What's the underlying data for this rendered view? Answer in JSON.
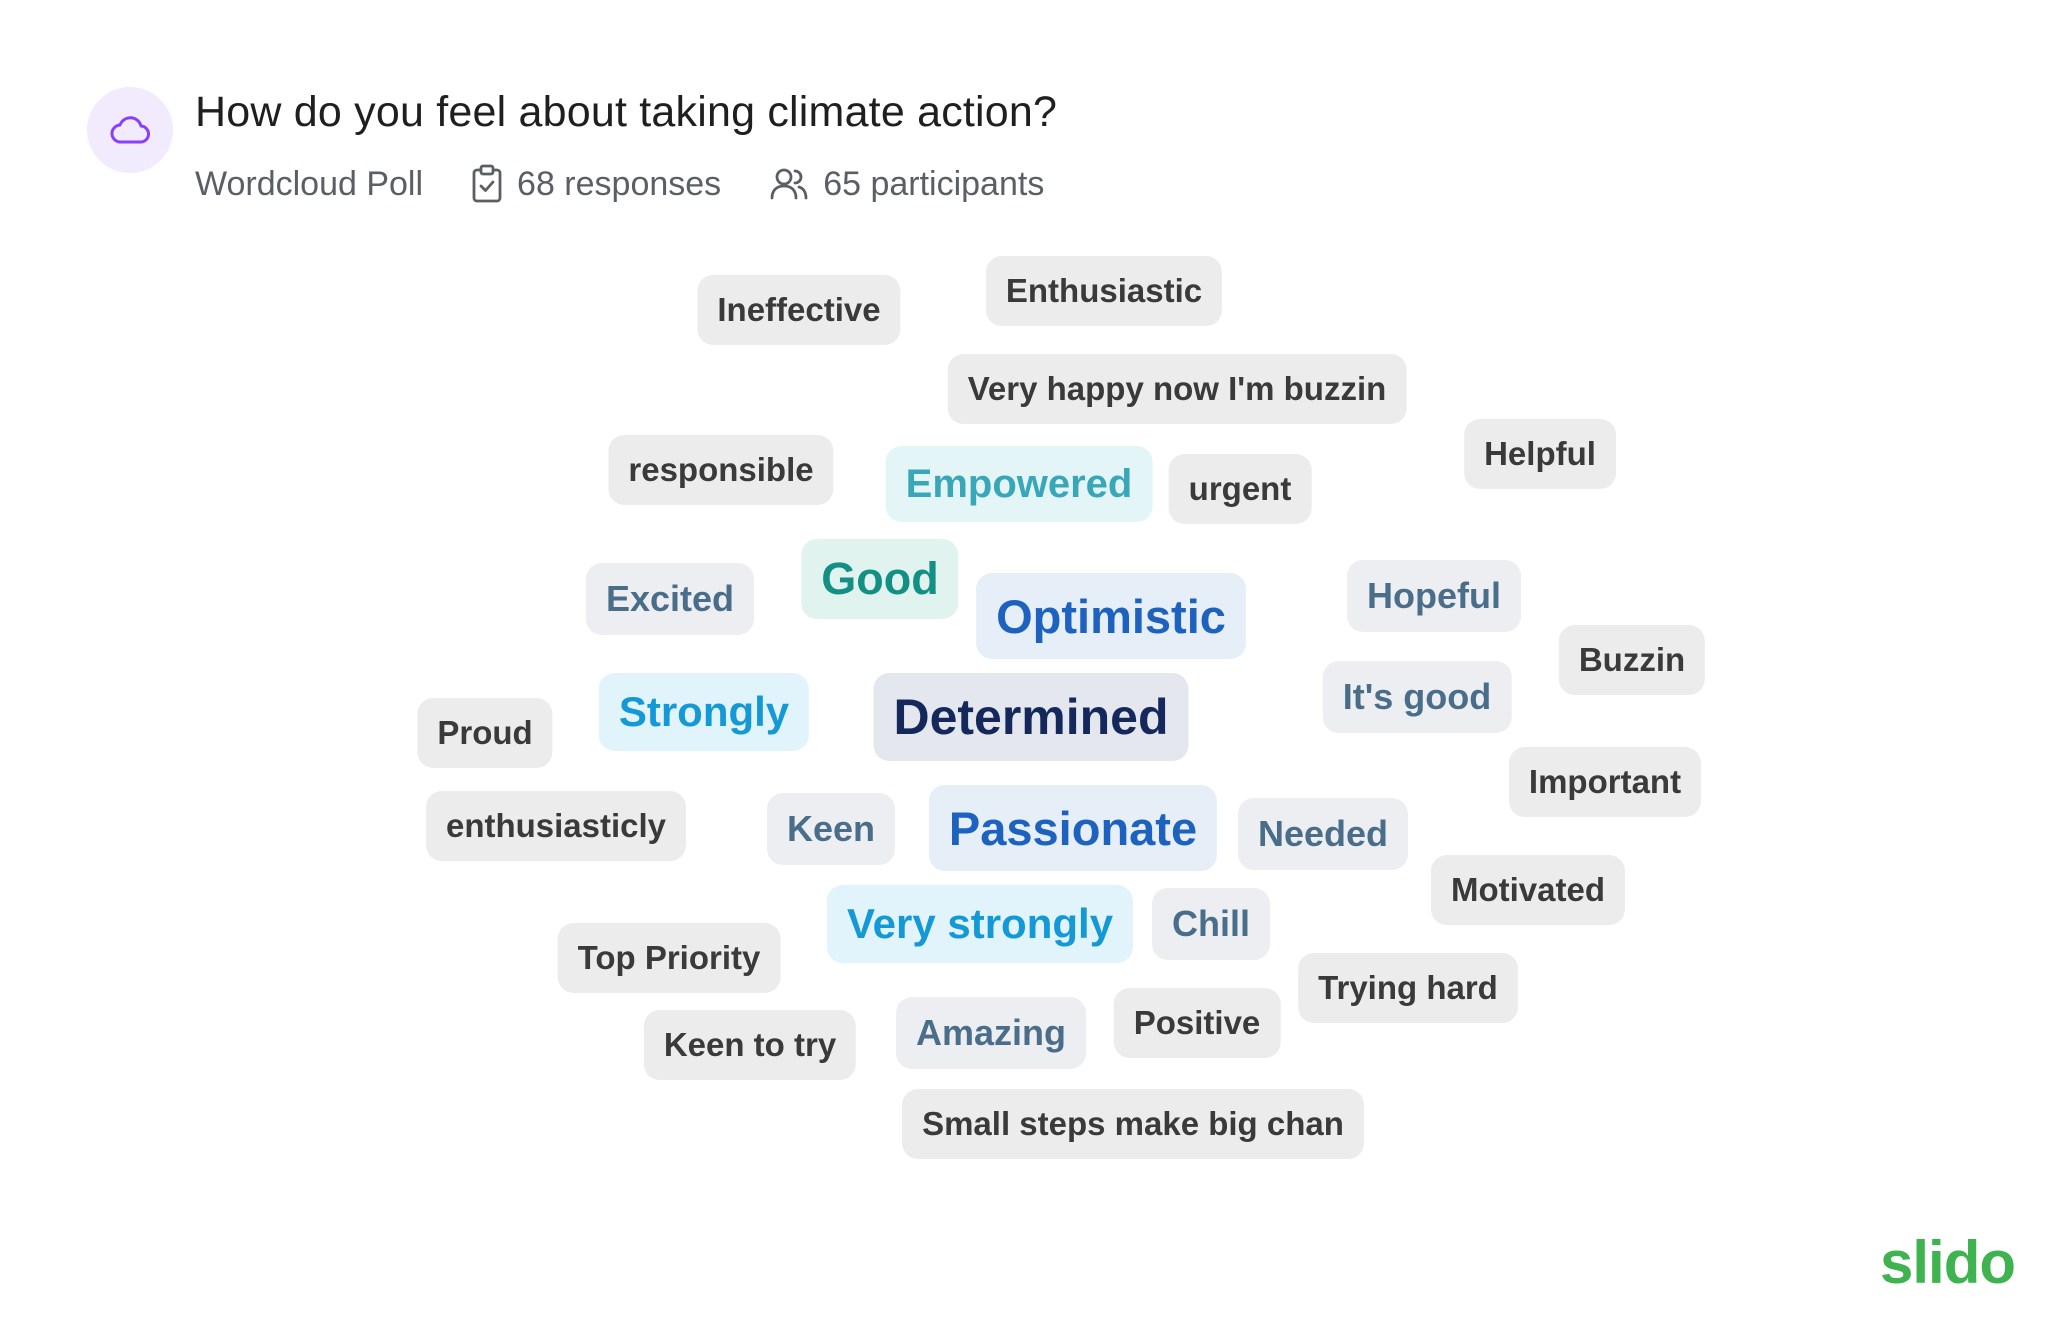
{
  "question": {
    "title": "How do you feel about taking climate action?",
    "type_label": "Wordcloud Poll",
    "responses": "68 responses",
    "participants": "65 participants"
  },
  "icons": {
    "poll": "cloud-icon",
    "responses": "clipboard-check-icon",
    "participants": "users-icon"
  },
  "colors": {
    "accent_purple": "#8a3ffc",
    "brand_green": "#3fb34f"
  },
  "words": [
    {
      "text": "Ineffective",
      "style": "gray"
    },
    {
      "text": "Enthusiastic",
      "style": "gray"
    },
    {
      "text": "Very happy now I'm buzzin",
      "style": "gray"
    },
    {
      "text": "responsible",
      "style": "gray"
    },
    {
      "text": "Empowered",
      "style": "teal-light"
    },
    {
      "text": "urgent",
      "style": "gray"
    },
    {
      "text": "Helpful",
      "style": "gray"
    },
    {
      "text": "Excited",
      "style": "slate"
    },
    {
      "text": "Good",
      "style": "teal"
    },
    {
      "text": "Optimistic",
      "style": "blue"
    },
    {
      "text": "Hopeful",
      "style": "slate"
    },
    {
      "text": "Buzzin",
      "style": "gray"
    },
    {
      "text": "Proud",
      "style": "gray"
    },
    {
      "text": "Strongly",
      "style": "sky"
    },
    {
      "text": "Determined",
      "style": "navy"
    },
    {
      "text": "It's good",
      "style": "slate"
    },
    {
      "text": "Important",
      "style": "gray"
    },
    {
      "text": "enthusiasticly",
      "style": "gray"
    },
    {
      "text": "Keen",
      "style": "slate"
    },
    {
      "text": "Passionate",
      "style": "blue"
    },
    {
      "text": "Needed",
      "style": "slate"
    },
    {
      "text": "Motivated",
      "style": "gray"
    },
    {
      "text": "Very strongly",
      "style": "sky"
    },
    {
      "text": "Chill",
      "style": "slate"
    },
    {
      "text": "Top Priority",
      "style": "gray"
    },
    {
      "text": "Trying hard",
      "style": "gray"
    },
    {
      "text": "Keen to try",
      "style": "gray"
    },
    {
      "text": "Amazing",
      "style": "slate"
    },
    {
      "text": "Positive",
      "style": "gray"
    },
    {
      "text": "Small steps make big chan",
      "style": "gray"
    }
  ],
  "logo": {
    "text": "slido"
  }
}
